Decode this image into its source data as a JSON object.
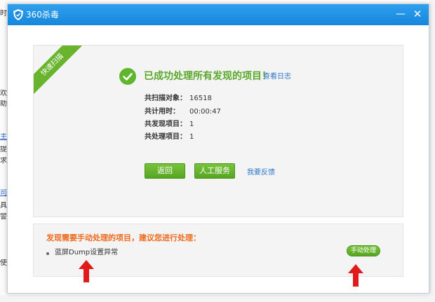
{
  "window": {
    "title": "360杀毒",
    "minimize_glyph": "—",
    "close_glyph": "✕"
  },
  "background": {
    "fragments": [
      "时",
      "欢",
      "助",
      "主",
      "提",
      "求",
      "司",
      "具",
      "警",
      "使"
    ]
  },
  "result": {
    "ribbon": "快速扫描",
    "title": "已成功处理所有发现的项目！",
    "view_log": "查看日志",
    "stats": [
      {
        "label": "共扫描对象：",
        "value": "16518"
      },
      {
        "label": "共计用时：",
        "value": "00:00:47"
      },
      {
        "label": "共发现项目：",
        "value": "1"
      },
      {
        "label": "共处理项目：",
        "value": "1"
      }
    ],
    "back_button": "返回",
    "service_button": "人工服务",
    "feedback_link": "我要反馈"
  },
  "manual": {
    "title": "发现需要手动处理的项目，建议您进行处理：",
    "items": [
      {
        "text": "蓝屏Dump设置异常",
        "action": "手动处理"
      }
    ]
  },
  "colors": {
    "titlebar": "#1e90e6",
    "accent_green": "#5fb52d",
    "warning_orange": "#ee6a1c",
    "link_blue": "#2b77c9",
    "arrow_red": "#e01b1b"
  },
  "icons": {
    "app": "shield-icon",
    "success": "check-circle-icon",
    "annotation": "red-arrow-up-icon"
  }
}
